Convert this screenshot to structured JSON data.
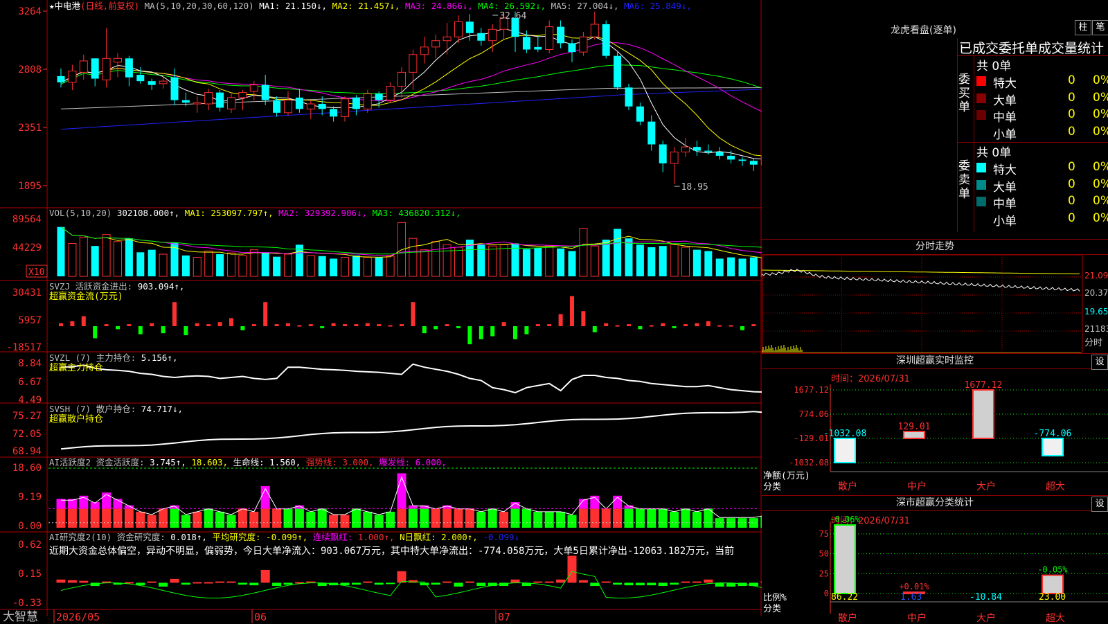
{
  "stock": {
    "name": "中电港",
    "period": "日线",
    "adjust": "前复权",
    "star": "★"
  },
  "price_panel": {
    "ma_params": "MA(5,10,20,30,60,120)",
    "ma_values": [
      {
        "label": "MA1:",
        "value": "21.150",
        "arrow": "↓",
        "color": "#ffffff"
      },
      {
        "label": "MA2:",
        "value": "21.457",
        "arrow": "↓",
        "color": "#ffff00"
      },
      {
        "label": "MA3:",
        "value": "24.866",
        "arrow": "↓",
        "color": "#ff00ff"
      },
      {
        "label": "MA4:",
        "value": "26.592",
        "arrow": "↓",
        "color": "#00ff00"
      },
      {
        "label": "MA5:",
        "value": "27.004",
        "arrow": "↓",
        "color": "#c0c0c0"
      },
      {
        "label": "MA6:",
        "value": "25.849",
        "arrow": "↓",
        "color": "#2222ff"
      }
    ],
    "y_ticks": [
      "3264",
      "2808",
      "2351",
      "1895"
    ],
    "high_label": "32.64",
    "low_label": "18.95"
  },
  "vol_panel": {
    "title": "VOL(5,10,20)",
    "value": "302108.000",
    "ma": [
      {
        "label": "MA1:",
        "value": "253097.797",
        "arrow": "↑",
        "color": "#ffff00"
      },
      {
        "label": "MA2:",
        "value": "329392.906",
        "arrow": "↓",
        "color": "#ff00ff"
      },
      {
        "label": "MA3:",
        "value": "436820.312",
        "arrow": "↓",
        "color": "#00ff00"
      }
    ],
    "y_ticks": [
      "89564",
      "44229"
    ],
    "unit": "X10"
  },
  "svzj_panel": {
    "title": "SVZJ",
    "label": "活跃资金进出:",
    "value": "903.094",
    "arrow": "↑",
    "subtitle": "超赢资金流(万元)",
    "y_ticks": [
      "30431",
      "5957",
      "-18517"
    ]
  },
  "svzl_panel": {
    "title": "SVZL (7)",
    "label": "主力持仓:",
    "value": "5.156",
    "arrow": "↑",
    "subtitle": "超赢主力持仓",
    "y_ticks": [
      "8.84",
      "6.67",
      "4.49"
    ]
  },
  "svsh_panel": {
    "title": "SVSH (7)",
    "label": "散户持仓:",
    "value": "74.717",
    "arrow": "↓",
    "subtitle": "超赢散户持仓",
    "y_ticks": [
      "75.27",
      "72.05",
      "68.94"
    ]
  },
  "ai_active_panel": {
    "title": "AI活跃度2",
    "label": "资金活跃度:",
    "value": "3.745",
    "value2": "18.603,",
    "life_label": "生命线:",
    "life_value": "1.560,",
    "strong_label": "强势线:",
    "strong_value": "3.000,",
    "burst_label": "爆发线:",
    "burst_value": "6.000,",
    "y_ticks": [
      "18.60",
      "9.19",
      "0.00"
    ]
  },
  "ai_research_panel": {
    "title": "AI研究度2(10)",
    "label": "资金研究度:",
    "value": "0.018",
    "avg_label": "平均研究度:",
    "avg_value": "-0.099",
    "red_label": "连续飘红:",
    "red_value": "1.000",
    "nred_label": "N日飘红:",
    "nred_value": "2.000",
    "last_value": "-0.099",
    "comment": "近期大资金总体偏空，异动不明显，偏弱势，今日大单净流入：903.067万元，其中特大单净流出：-774.058万元，大单5日累计净出-12063.182万元，当前",
    "y_ticks": [
      "0.62",
      "0.15",
      "-0.33"
    ]
  },
  "x_axis": {
    "labels": [
      "2026/05",
      "06",
      "07"
    ],
    "brand": "大智慧"
  },
  "dragon": {
    "title": "龙虎看盘(逐单)",
    "btn1": "柱",
    "btn2": "笔",
    "header": "已成交委托单成交量统计",
    "buy_side": "委买单",
    "sell_side": "委卖单",
    "buy_total": "共 0单",
    "sell_total": "共 0单",
    "buy_rows": [
      {
        "label": "特大",
        "count": "0",
        "pct": "0%",
        "color": "#ff0000"
      },
      {
        "label": "大单",
        "count": "0",
        "pct": "0%",
        "color": "#8b0000"
      },
      {
        "label": "中单",
        "count": "0",
        "pct": "0%",
        "color": "#6b0000"
      },
      {
        "label": "小单",
        "count": "0",
        "pct": "0%",
        "color": "#000000"
      }
    ],
    "sell_rows": [
      {
        "label": "特大",
        "count": "0",
        "pct": "0%",
        "color": "#00ffff"
      },
      {
        "label": "大单",
        "count": "0",
        "pct": "0%",
        "color": "#008b8b"
      },
      {
        "label": "中单",
        "count": "0",
        "pct": "0%",
        "color": "#006b6b"
      },
      {
        "label": "小单",
        "count": "0",
        "pct": "0%",
        "color": "#000000"
      }
    ]
  },
  "intraday": {
    "title": "分时走势",
    "prices": [
      "21.09",
      "20.37",
      "19.65"
    ],
    "vol": "21183",
    "vol_label": "分时"
  },
  "shenzhen_monitor": {
    "title": "深圳超赢实时监控",
    "settings": "设",
    "date_label": "时间：2026/07/31",
    "y_ticks": [
      "1677.12",
      "774.06",
      "-129.01",
      "-1032.08"
    ],
    "ylabel": "净额(万元)",
    "xlabel": "分类",
    "categories": [
      "散户",
      "中户",
      "大户",
      "超大"
    ],
    "values": [
      -1032.08,
      129.01,
      1677.12,
      -774.06
    ],
    "value_labels": [
      "-1032.08",
      "129.01",
      "1677.12",
      "-774.06"
    ],
    "value_colors": [
      "#00ffff",
      "#ff3030",
      "#ff3030",
      "#00ffff"
    ]
  },
  "classify": {
    "title": "深市超赢分类统计",
    "settings": "设",
    "date_label": "时间：2026/07/31",
    "y_ticks": [
      "75",
      "50",
      "25",
      "0"
    ],
    "ylabel": "比例%",
    "xlabel": "分类",
    "categories": [
      "散户",
      "中户",
      "大户",
      "超大"
    ],
    "values": [
      86.22,
      1.63,
      -10.84,
      23.0
    ],
    "value_labels": [
      "86.22",
      "1.63",
      "-10.84",
      "23.00"
    ],
    "value_colors": [
      "#ffff00",
      "#2255ff",
      "#00ffff",
      "#ffff00"
    ],
    "changes": [
      "-0.06%",
      "+0.01%",
      "",
      "-0.05%"
    ],
    "change_colors": [
      "#00ff00",
      "#ff3030",
      "#00ff00",
      "#00ff00"
    ]
  },
  "chart_data": {
    "type": "candlestick",
    "series": [
      {
        "name": "中电港",
        "ohlc": [
          [
            27.5,
            28.1,
            26.6,
            27.0
          ],
          [
            27.0,
            28.4,
            26.4,
            27.9
          ],
          [
            27.8,
            29.2,
            27.2,
            28.7
          ],
          [
            28.9,
            28.9,
            26.7,
            27.3
          ],
          [
            27.2,
            31.3,
            26.6,
            28.9
          ],
          [
            28.6,
            29.3,
            27.4,
            28.9
          ],
          [
            28.9,
            29.1,
            26.7,
            27.4
          ],
          [
            27.6,
            28.2,
            26.9,
            27.1
          ],
          [
            27.1,
            27.3,
            26.4,
            26.8
          ],
          [
            26.9,
            27.5,
            26.5,
            27.1
          ],
          [
            27.4,
            28.1,
            25.2,
            25.6
          ],
          [
            25.6,
            26.2,
            25.1,
            25.4
          ],
          [
            25.3,
            25.9,
            24.6,
            25.4
          ],
          [
            25.3,
            26.5,
            24.8,
            26.2
          ],
          [
            26.2,
            26.4,
            24.7,
            25.0
          ],
          [
            24.9,
            26.1,
            24.6,
            25.8
          ],
          [
            25.8,
            26.4,
            24.8,
            26.2
          ],
          [
            26.3,
            27.1,
            25.6,
            26.8
          ],
          [
            26.8,
            27.6,
            25.2,
            25.6
          ],
          [
            25.6,
            25.9,
            24.3,
            24.6
          ],
          [
            24.6,
            26.3,
            24.4,
            25.6
          ],
          [
            25.8,
            26.5,
            24.6,
            24.9
          ],
          [
            24.9,
            25.6,
            24.1,
            25.3
          ],
          [
            25.3,
            25.9,
            24.4,
            24.9
          ],
          [
            24.9,
            25.1,
            23.9,
            24.3
          ],
          [
            24.3,
            25.9,
            23.9,
            25.7
          ],
          [
            25.8,
            26.0,
            24.4,
            24.9
          ],
          [
            24.9,
            26.4,
            24.6,
            26.1
          ],
          [
            26.1,
            26.3,
            25.0,
            25.6
          ],
          [
            25.6,
            27.0,
            25.4,
            26.7
          ],
          [
            26.7,
            28.2,
            25.8,
            27.8
          ],
          [
            27.8,
            29.6,
            26.4,
            29.2
          ],
          [
            29.2,
            30.6,
            28.5,
            29.8
          ],
          [
            29.8,
            30.8,
            28.9,
            30.3
          ],
          [
            30.3,
            31.7,
            29.2,
            30.6
          ],
          [
            30.6,
            32.3,
            30.1,
            31.8
          ],
          [
            31.8,
            32.4,
            30.3,
            30.9
          ],
          [
            30.9,
            31.3,
            29.9,
            30.3
          ],
          [
            30.3,
            31.6,
            29.4,
            31.2
          ],
          [
            31.2,
            32.6,
            30.4,
            32.1
          ],
          [
            32.1,
            32.6,
            29.4,
            30.6
          ],
          [
            30.6,
            31.1,
            29.3,
            29.6
          ],
          [
            29.8,
            30.7,
            29.4,
            29.6
          ],
          [
            29.6,
            31.9,
            29.3,
            31.4
          ],
          [
            31.4,
            31.9,
            29.7,
            30.1
          ],
          [
            30.1,
            30.4,
            28.6,
            29.4
          ],
          [
            29.4,
            31.0,
            29.1,
            30.6
          ],
          [
            30.6,
            32.6,
            30.4,
            31.6
          ],
          [
            31.6,
            31.9,
            28.9,
            29.1
          ],
          [
            29.1,
            29.4,
            26.4,
            26.6
          ],
          [
            26.6,
            26.9,
            24.8,
            25.1
          ],
          [
            25.1,
            25.4,
            23.6,
            23.9
          ],
          [
            23.9,
            24.4,
            21.6,
            22.1
          ],
          [
            22.1,
            22.4,
            19.9,
            20.6
          ],
          [
            20.6,
            21.9,
            18.95,
            21.5
          ],
          [
            21.5,
            22.6,
            21.1,
            21.9
          ],
          [
            21.9,
            22.4,
            21.2,
            21.6
          ],
          [
            21.6,
            22.1,
            21.3,
            21.5
          ],
          [
            21.5,
            21.9,
            20.9,
            21.2
          ],
          [
            21.2,
            21.6,
            20.6,
            20.9
          ],
          [
            20.9,
            21.1,
            20.4,
            20.8
          ],
          [
            20.8,
            21.0,
            20.0,
            20.5
          ],
          [
            20.5,
            21.4,
            20.4,
            21.2
          ]
        ]
      }
    ]
  }
}
